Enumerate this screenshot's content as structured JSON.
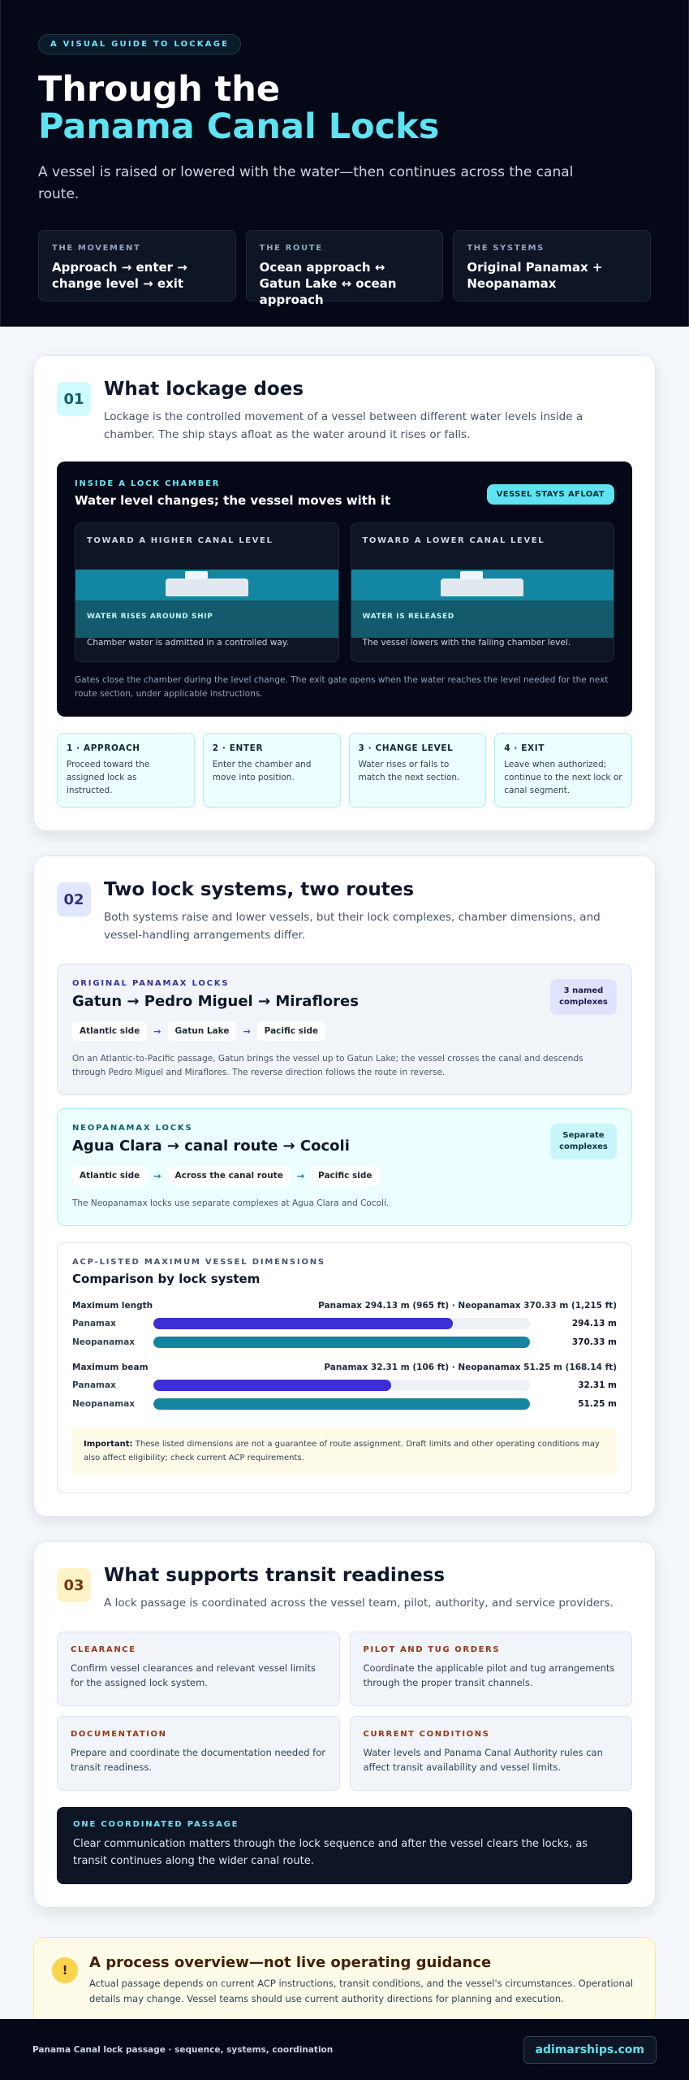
{
  "hero": {
    "kicker": "A VISUAL GUIDE TO LOCKAGE",
    "title_line1": "Through the",
    "title_line2": "Panama Canal Locks",
    "lead": "A vessel is raised or lowered with the water—then continues across the canal route.",
    "cards": [
      {
        "label": "THE MOVEMENT",
        "value": "Approach → enter → change level → exit"
      },
      {
        "label": "THE ROUTE",
        "value": "Ocean approach ↔ Gatun Lake ↔ ocean approach"
      },
      {
        "label": "THE SYSTEMS",
        "value": "Original Panamax + Neopanamax"
      }
    ]
  },
  "s1": {
    "num": "01",
    "title": "What lockage does",
    "lead": "Lockage is the controlled movement of a vessel between different water levels inside a chamber. The ship stays afloat as the water around it rises or falls.",
    "chamber": {
      "kicker": "INSIDE A LOCK CHAMBER",
      "title": "Water level changes; the vessel moves with it",
      "pill": "VESSEL STAYS AFLOAT",
      "panels": [
        {
          "label": "TOWARD A HIGHER CANAL LEVEL",
          "water_note": "WATER RISES AROUND SHIP",
          "desc": "Chamber water is admitted in a controlled way."
        },
        {
          "label": "TOWARD A LOWER CANAL LEVEL",
          "water_note": "WATER IS RELEASED",
          "desc": "The vessel lowers with the falling chamber level."
        }
      ],
      "foot": "Gates close the chamber during the level change. The exit gate opens when the water reaches the level needed for the next route section, under applicable instructions."
    },
    "steps": [
      {
        "title": "1 · APPROACH",
        "desc": "Proceed toward the assigned lock as instructed."
      },
      {
        "title": "2 · ENTER",
        "desc": "Enter the chamber and move into position."
      },
      {
        "title": "3 · CHANGE LEVEL",
        "desc": "Water rises or falls to match the next section."
      },
      {
        "title": "4 · EXIT",
        "desc": "Leave when authorized; continue to the next lock or canal segment."
      }
    ]
  },
  "s2": {
    "num": "02",
    "title": "Two lock systems, two routes",
    "lead": "Both systems raise and lower vessels, but their lock complexes, chamber dimensions, and vessel-handling arrangements differ.",
    "original": {
      "kicker": "ORIGINAL PANAMAX LOCKS",
      "title": "Gatun → Pedro Miguel → Miraflores",
      "badge": "3 named complexes",
      "chips": [
        "Atlantic side",
        "Gatun Lake",
        "Pacific side"
      ],
      "arrow": "→",
      "note": "On an Atlantic-to-Pacific passage, Gatun brings the vessel up to Gatun Lake; the vessel crosses the canal and descends through Pedro Miguel and Miraflores. The reverse direction follows the route in reverse."
    },
    "neo": {
      "kicker": "NEOPANAMAX LOCKS",
      "title": "Agua Clara → canal route → Cocoli",
      "badge": "Separate complexes",
      "chips": [
        "Atlantic side",
        "Across the canal route",
        "Pacific side"
      ],
      "arrow": "→",
      "note": "The Neopanamax locks use separate complexes at Agua Clara and Cocolí."
    },
    "dims": {
      "kicker": "ACP-LISTED MAXIMUM VESSEL DIMENSIONS",
      "title": "Comparison by lock system",
      "metrics": [
        {
          "label": "Maximum length",
          "summary": "Panamax 294.13 m (965 ft) · Neopanamax 370.33 m (1,215 ft)",
          "rows": [
            {
              "name": "Panamax",
              "value": 294.13,
              "value_label": "294.13 m",
              "color": "#3b2fd6"
            },
            {
              "name": "Neopanamax",
              "value": 370.33,
              "value_label": "370.33 m",
              "color": "#14849f"
            }
          ],
          "max": 370.33
        },
        {
          "label": "Maximum beam",
          "summary": "Panamax 32.31 m (106 ft) · Neopanamax 51.25 m (168.14 ft)",
          "rows": [
            {
              "name": "Panamax",
              "value": 32.31,
              "value_label": "32.31 m",
              "color": "#3b2fd6"
            },
            {
              "name": "Neopanamax",
              "value": 51.25,
              "value_label": "51.25 m",
              "color": "#14849f"
            }
          ],
          "max": 51.25
        }
      ],
      "important_label": "Important:",
      "important_text": "These listed dimensions are not a guarantee of route assignment. Draft limits and other operating conditions may also affect eligibility; check current ACP requirements."
    }
  },
  "s3": {
    "num": "03",
    "title": "What supports transit readiness",
    "lead": "A lock passage is coordinated across the vessel team, pilot, authority, and service providers.",
    "cards": [
      {
        "kicker": "CLEARANCE",
        "desc": "Confirm vessel clearances and relevant vessel limits for the assigned lock system."
      },
      {
        "kicker": "PILOT AND TUG ORDERS",
        "desc": "Coordinate the applicable pilot and tug arrangements through the proper transit channels."
      },
      {
        "kicker": "DOCUMENTATION",
        "desc": "Prepare and coordinate the documentation needed for transit readiness."
      },
      {
        "kicker": "CURRENT CONDITIONS",
        "desc": "Water levels and Panama Canal Authority rules can affect transit availability and vessel limits."
      }
    ],
    "coord": {
      "kicker": "ONE COORDINATED PASSAGE",
      "desc": "Clear communication matters through the lock sequence and after the vessel clears the locks, as transit continues along the wider canal route."
    }
  },
  "overview": {
    "icon": "!",
    "title": "A process overview—not live operating guidance",
    "desc": "Actual passage depends on current ACP instructions, transit conditions, and the vessel's circumstances. Operational details may change. Vessel teams should use current authority directions for planning and execution."
  },
  "footer": {
    "text": "Panama Canal lock passage · sequence, systems, coordination",
    "brand": "adimarships.com"
  },
  "colors": {
    "accent_cyan": "#5ee3f2",
    "panamax_bar": "#3b2fd6",
    "neopanamax_bar": "#14849f"
  }
}
